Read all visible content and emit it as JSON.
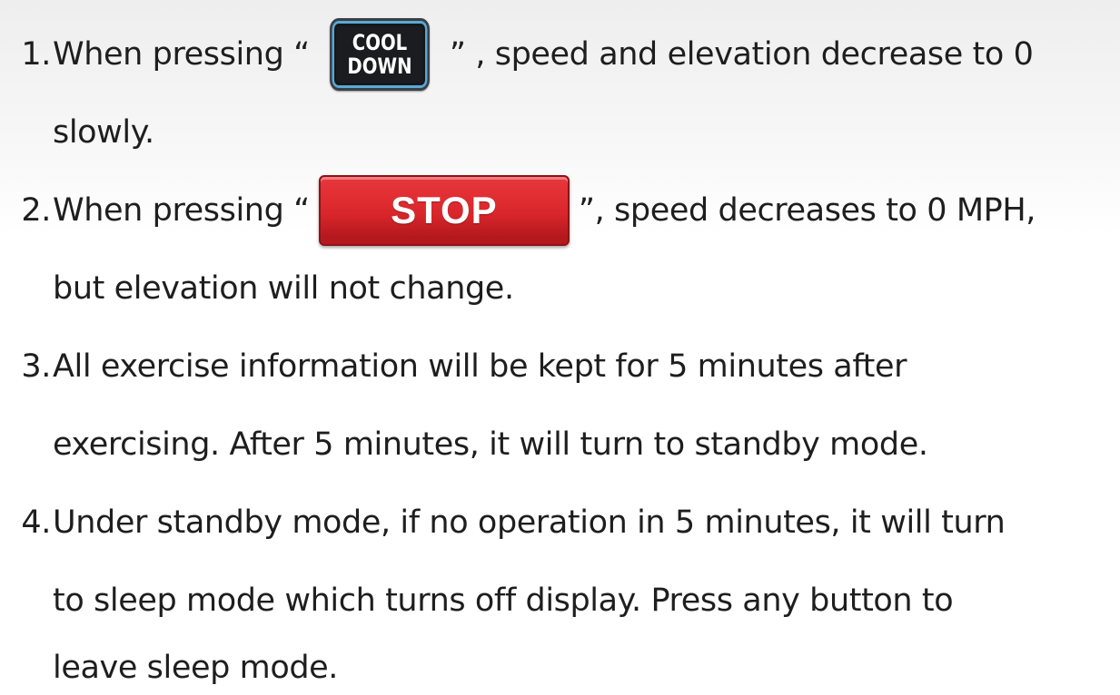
{
  "items": [
    {
      "number": "1.",
      "lines": [
        {
          "before": "When pressing “",
          "after": "” , speed and elevation decrease to 0"
        },
        {
          "text": "slowly."
        }
      ],
      "button": {
        "label_top": "COOL",
        "label_bottom": "DOWN"
      }
    },
    {
      "number": "2.",
      "lines": [
        {
          "before": "When pressing “",
          "after": "”, speed decreases to 0 MPH,"
        },
        {
          "text": "but elevation will not change."
        }
      ],
      "button": {
        "label": "STOP"
      }
    },
    {
      "number": "3.",
      "lines": [
        {
          "text": "All exercise information will be kept for 5 minutes after"
        },
        {
          "text": "exercising. After 5 minutes, it will turn to standby mode."
        }
      ]
    },
    {
      "number": "4.",
      "lines": [
        {
          "text": "Under standby mode, if no operation in 5 minutes, it will turn"
        },
        {
          "text": "to sleep mode which turns off display. Press any button to"
        },
        {
          "text": "leave sleep mode."
        }
      ]
    }
  ],
  "colors": {
    "text": "#1e1e1e",
    "stop_red": "#d9262b",
    "cool_down_dark": "#1a1c1f",
    "cool_down_accent": "#5aa9d6"
  }
}
